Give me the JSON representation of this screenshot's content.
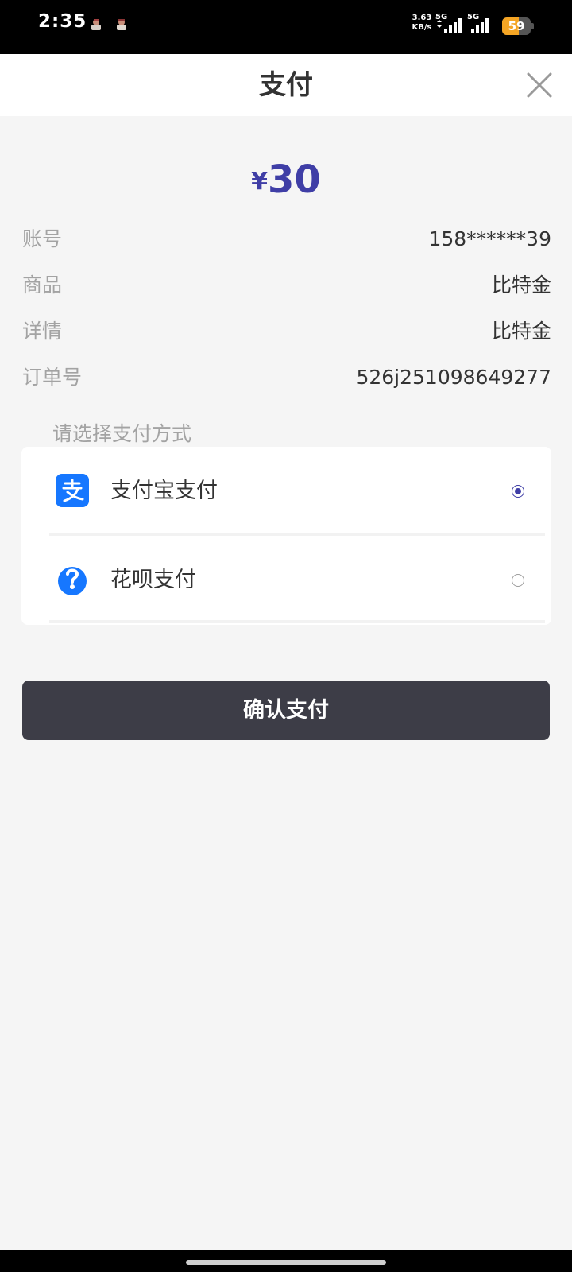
{
  "status_bar": {
    "time": "2:35",
    "net_speed_value": "3.63",
    "net_speed_unit": "KB/s",
    "network_1": "5G",
    "network_2": "5G",
    "battery": "59",
    "notification_icons": [
      "game-app-icon",
      "game-app-icon"
    ]
  },
  "header": {
    "title": "支付",
    "close_icon": "close-icon"
  },
  "amount": {
    "symbol": "¥",
    "value": "30",
    "color": "#3f3ea6"
  },
  "info": [
    {
      "label": "账号",
      "value": "158******39"
    },
    {
      "label": "商品",
      "value": "比特金"
    },
    {
      "label": "详情",
      "value": "比特金"
    },
    {
      "label": "订单号",
      "value": "526j251098649277"
    }
  ],
  "payment": {
    "section_title": "请选择支付方式",
    "options": [
      {
        "label": "支付宝支付",
        "icon": "alipay-icon",
        "selected": true
      },
      {
        "label": "花呗支付",
        "icon": "huabei-icon",
        "selected": false
      }
    ]
  },
  "confirm_label": "确认支付",
  "colors": {
    "accent": "#3f3ea6",
    "alipay_blue": "#1677ff",
    "button": "#3d3d47"
  }
}
